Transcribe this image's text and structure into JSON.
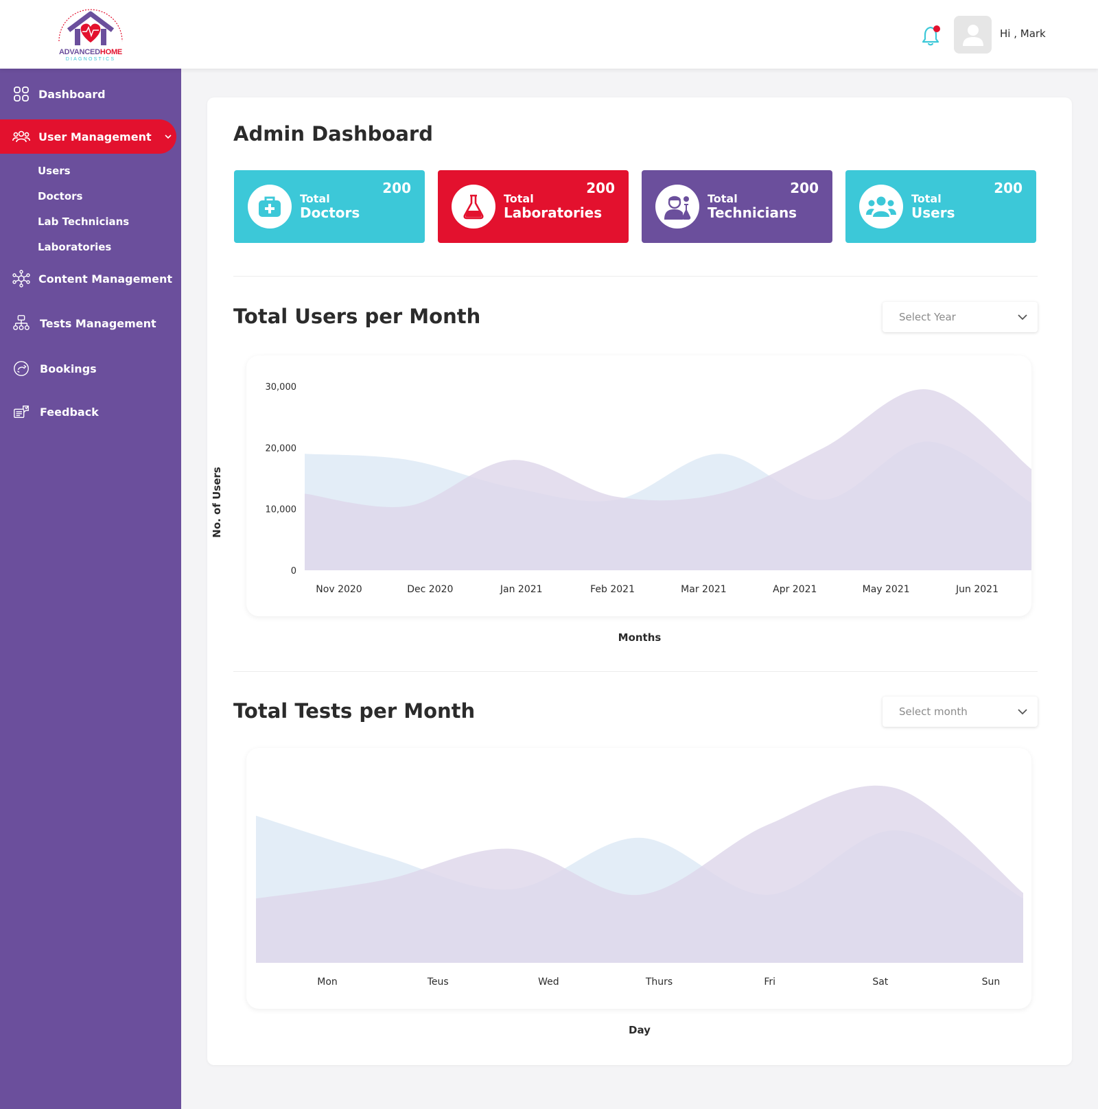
{
  "header": {
    "logo": {
      "word_part1": "ADVANCED",
      "word_part2": "HOME",
      "subtitle": "DIAGNOSTICS",
      "arc_text": "Bringing the Best Services you need to the location you want"
    },
    "notification_count": "1",
    "greeting": "Hi , Mark"
  },
  "sidebar": {
    "items": [
      {
        "label": "Dashboard",
        "icon": "grid-icon"
      },
      {
        "label": "User Management",
        "icon": "users-icon",
        "active": true
      },
      {
        "label": "Content Management",
        "icon": "network-icon"
      },
      {
        "label": "Tests Management",
        "icon": "hierarchy-icon"
      },
      {
        "label": "Bookings",
        "icon": "bookings-icon"
      },
      {
        "label": "Feedback",
        "icon": "feedback-icon"
      }
    ],
    "sub_items": [
      "Users",
      "Doctors",
      "Lab Technicians",
      "Laboratories"
    ]
  },
  "main": {
    "title": "Admin Dashboard",
    "stats": [
      {
        "line1": "Total",
        "line2": "Doctors",
        "count": "200",
        "color": "#3cc8d8",
        "icon": "first-aid-kit-icon"
      },
      {
        "line1": "Total",
        "line2": "Laboratories",
        "count": "200",
        "color": "#e3112e",
        "icon": "flask-icon"
      },
      {
        "line1": "Total",
        "line2": "Technicians",
        "count": "200",
        "color": "#6b4f9c",
        "icon": "technician-icon"
      },
      {
        "line1": "Total",
        "line2": "Users",
        "count": "200",
        "color": "#3cc8d8",
        "icon": "users-group-icon"
      }
    ],
    "users_section": {
      "title": "Total Users per Month",
      "select_value": "Select Year"
    },
    "tests_section": {
      "title": "Total Tests per Month",
      "select_value": "Select month"
    }
  },
  "colors": {
    "purple": "#6b4f9c",
    "red": "#e3112e",
    "cyan": "#3cc8d8",
    "series_blue": "#dce8f5",
    "series_purple": "#ddd6ea"
  },
  "chart_data": [
    {
      "type": "area",
      "ylabel": "No. of Users",
      "xlabel": "Months",
      "categories": [
        "Nov 2020",
        "Dec 2020",
        "Jan 2021",
        "Feb 2021",
        "Mar 2021",
        "Apr 2021",
        "May 2021",
        "Jun 2021"
      ],
      "yticks": [
        "30,000",
        "20,000",
        "10,000",
        "0"
      ],
      "ylim": [
        0,
        30000
      ],
      "series": [
        {
          "values": [
            19000,
            18000,
            13500,
            11500,
            19000,
            11500,
            21000,
            11000
          ]
        },
        {
          "values": [
            12500,
            10500,
            18000,
            12000,
            12500,
            20000,
            29500,
            16500
          ]
        }
      ]
    },
    {
      "type": "area",
      "xlabel": "Day",
      "categories": [
        "Mon",
        "Teus",
        "Wed",
        "Thurs",
        "Fri",
        "Sat",
        "Sun"
      ],
      "series": [
        {
          "values": [
            80,
            58,
            40,
            68,
            37,
            72,
            35
          ]
        },
        {
          "values": [
            35,
            45,
            62,
            37,
            75,
            95,
            38
          ]
        }
      ]
    }
  ]
}
